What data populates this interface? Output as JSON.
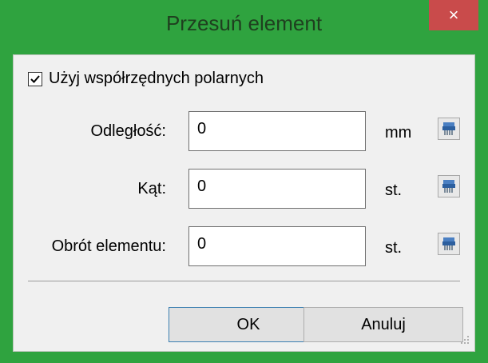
{
  "window": {
    "title": "Przesuń element",
    "close_symbol": "×"
  },
  "options": {
    "polar_label": "Użyj współrzędnych polarnych",
    "polar_checked": true
  },
  "fields": [
    {
      "label": "Odległość:",
      "value": "0",
      "unit": "mm",
      "tool_icon": "shredder-icon"
    },
    {
      "label": "Kąt:",
      "value": "0",
      "unit": "st.",
      "tool_icon": "shredder-icon"
    },
    {
      "label": "Obrót elementu:",
      "value": "0",
      "unit": "st.",
      "tool_icon": "shredder-icon"
    }
  ],
  "buttons": {
    "ok": "OK",
    "cancel": "Anuluj"
  },
  "colors": {
    "frame": "#2fa33f",
    "close": "#c94b4b",
    "client": "#f0f0f0"
  }
}
